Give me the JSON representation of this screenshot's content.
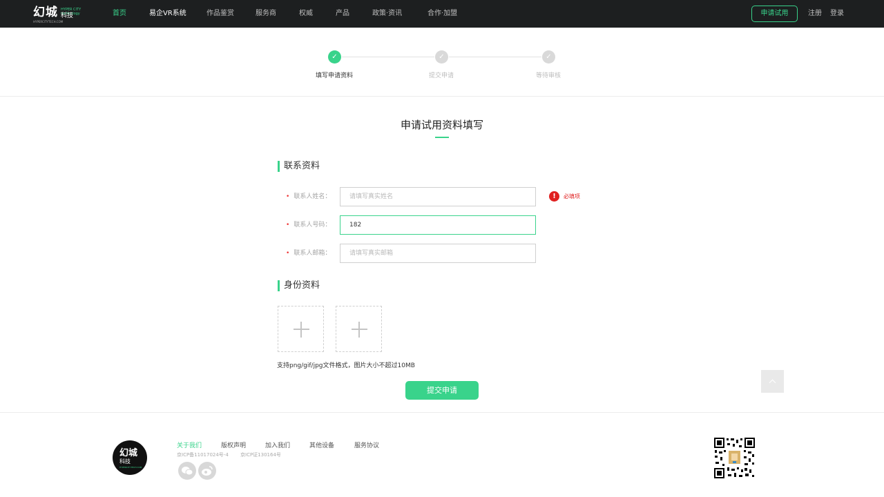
{
  "header": {
    "logo": {
      "main": "幻城",
      "en": "HYPER CITY technology",
      "kj": "科技",
      "sub": "HYPERCITYTECH.COM"
    },
    "nav": [
      "首页",
      "易企VR系统",
      "作品鉴赏",
      "服务商",
      "权威",
      "产品",
      "政策·资讯",
      "合作·加盟"
    ],
    "trial_button": "申请试用",
    "register": "注册",
    "login": "登录"
  },
  "steps": [
    {
      "label": "填写申请资料",
      "done": true
    },
    {
      "label": "提交申请",
      "done": false
    },
    {
      "label": "等待审核",
      "done": false
    }
  ],
  "form": {
    "title": "申请试用资料填写",
    "contact_section": "联系资料",
    "fields": [
      {
        "label": "联系人姓名：",
        "value": "",
        "placeholder": "请填写真实姓名"
      },
      {
        "label": "联系人号码：",
        "value": "182",
        "placeholder": ""
      },
      {
        "label": "联系人邮箱：",
        "value": "",
        "placeholder": "请填写真实邮箱"
      }
    ],
    "required_mark": "•",
    "error": {
      "icon": "!",
      "text": "必填项"
    },
    "identity_section": "身份资料",
    "upload_hint": "支持png/gif/jpg文件格式，图片大小不超过10MB",
    "submit": "提交申请"
  },
  "footer": {
    "logo": {
      "main": "幻城",
      "sub": "科技",
      "en": "HYPERCITYTECH.COM"
    },
    "links": [
      "关于我们",
      "版权声明",
      "加入我们",
      "其他设备",
      "服务协议"
    ],
    "icp": [
      "京ICP备11017024号-4",
      "京ICP证130164号"
    ],
    "social_icons": [
      "wechat-icon",
      "weibo-icon"
    ]
  },
  "colors": {
    "accent": "#39d38b",
    "error": "#e02020",
    "nav_bg": "#1d1f20"
  }
}
